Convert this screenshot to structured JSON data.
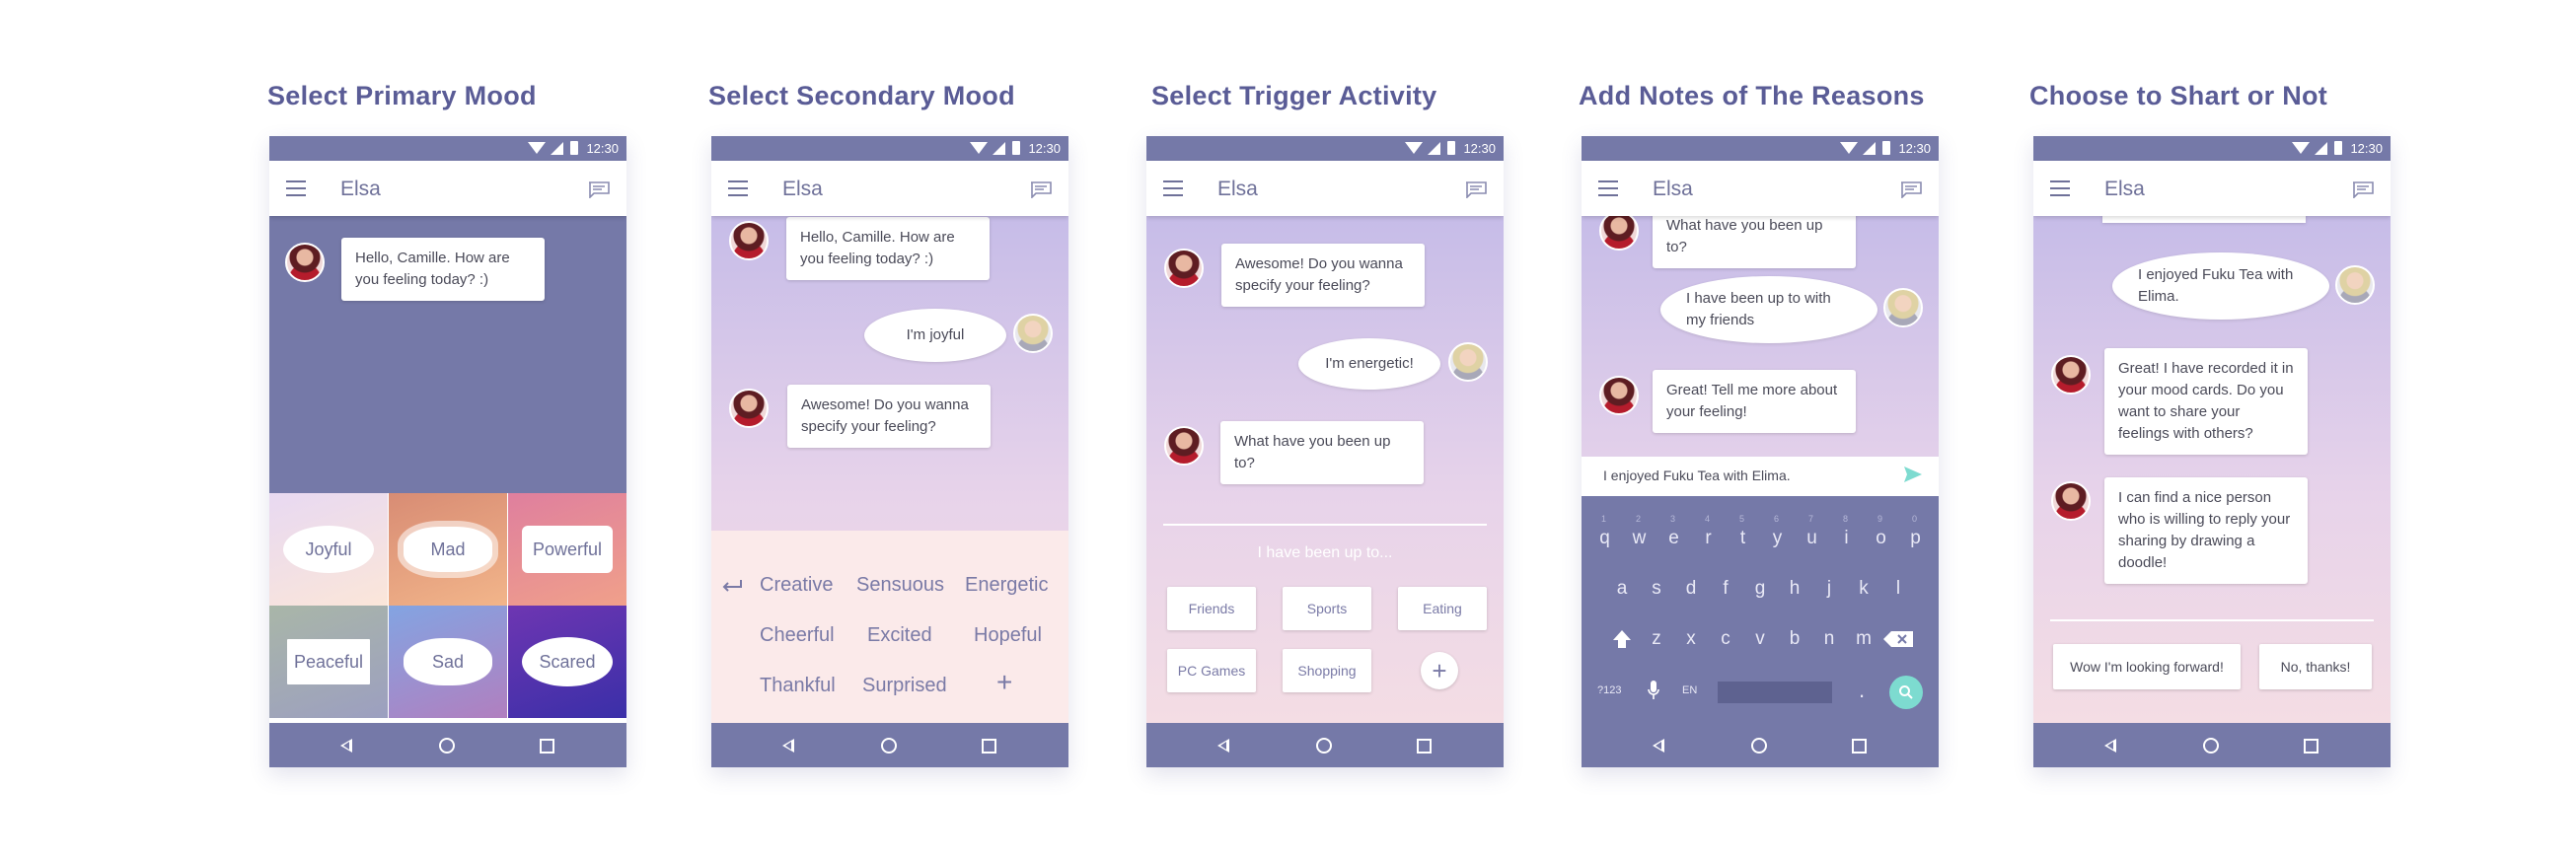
{
  "colors": {
    "title": "#5a5c96",
    "bar": "#7579a8",
    "accent": "#7ddbd0"
  },
  "shared": {
    "status_time": "12:30",
    "contact_name": "Elsa",
    "icons": {
      "menu": "hamburger-menu-icon",
      "chat": "chat-bubble-icon",
      "back": "back-triangle-icon",
      "home": "home-circle-icon",
      "recents": "recents-square-icon"
    }
  },
  "screens": [
    {
      "title": "Select Primary Mood",
      "bot_message": "Hello, Camille. How are you feeling today?  :)",
      "moods": [
        "Joyful",
        "Mad",
        "Powerful",
        "Peaceful",
        "Sad",
        "Scared"
      ]
    },
    {
      "title": "Select Secondary Mood",
      "bot_message_1": "Hello, Camille. How are you feeling today?  :)",
      "user_message": "I'm joyful",
      "bot_message_2": "Awesome! Do you wanna specify your feeling?",
      "options": [
        "Creative",
        "Sensuous",
        "Energetic",
        "Cheerful",
        "Excited",
        "Hopeful",
        "Thankful",
        "Surprised",
        "+"
      ]
    },
    {
      "title": "Select Trigger Activity",
      "bot_message_1": "Awesome! Do you wanna specify your feeling?",
      "user_message": "I'm energetic!",
      "bot_message_2": "What have you been up to?",
      "input_placeholder": "I have been up to...",
      "activities": [
        "Friends",
        "Sports",
        "Eating",
        "PC Games",
        "Shopping",
        "+"
      ]
    },
    {
      "title": "Add Notes of The Reasons",
      "bot_message_1": "What have you been up to?",
      "user_message": "I have been up to with my friends",
      "bot_message_2": "Great! Tell me more about your feeling!",
      "input_value": "I enjoyed Fuku Tea with Elima.",
      "keyboard": {
        "row1": [
          "q",
          "w",
          "e",
          "r",
          "t",
          "y",
          "u",
          "i",
          "o",
          "p"
        ],
        "row1_hints": [
          "1",
          "2",
          "3",
          "4",
          "5",
          "6",
          "7",
          "8",
          "9",
          "0"
        ],
        "row2": [
          "a",
          "s",
          "d",
          "f",
          "g",
          "h",
          "j",
          "k",
          "l"
        ],
        "row3": [
          "z",
          "x",
          "c",
          "v",
          "b",
          "n",
          "m"
        ],
        "sym_key": "?123",
        "lang_key": "EN",
        "period_key": "."
      }
    },
    {
      "title": "Choose to Shart or Not",
      "user_message": "I enjoyed Fuku Tea with Elima.",
      "bot_message_1": "Great! I have recorded it in your mood cards. Do you want to share your feelings with others?",
      "bot_message_2": "I can find a nice person who is willing to reply your sharing by drawing a doodle!",
      "choices": [
        "Wow I'm looking forward!",
        "No, thanks!"
      ]
    }
  ]
}
